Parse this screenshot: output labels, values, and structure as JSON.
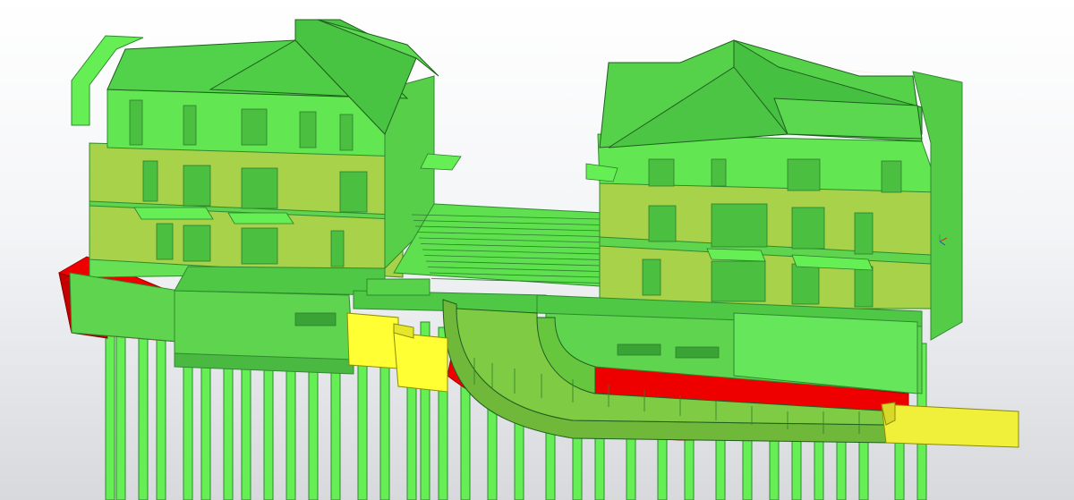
{
  "viewer": {
    "background_top": "#ffffff",
    "background_bottom": "#d7d9dd"
  },
  "model_colors": {
    "green_light": "#66ee55",
    "green_mid": "#55dd44",
    "green_olive": "#99cc44",
    "red": "#ef0000",
    "yellow": "#ffff33"
  },
  "axis_gizmo": {
    "icon": "view-axis-icon"
  }
}
